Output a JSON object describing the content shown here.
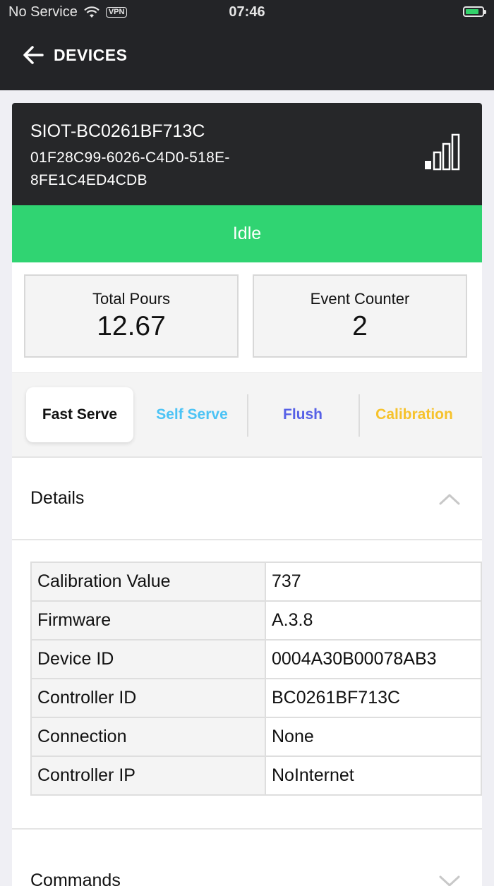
{
  "status_bar": {
    "carrier": "No Service",
    "vpn_label": "VPN",
    "time": "07:46"
  },
  "nav": {
    "back_icon": "arrow-left-icon",
    "title": "DEVICES"
  },
  "device": {
    "name": "SIOT-BC0261BF713C",
    "uuid": "01F28C99-6026-C4D0-518E-8FE1C4ED4CDB",
    "signal_icon": "signal-bars-icon",
    "state": "Idle",
    "state_color": "#30d472"
  },
  "stats": {
    "total_pours_label": "Total Pours",
    "total_pours_value": "12.67",
    "event_counter_label": "Event Counter",
    "event_counter_value": "2"
  },
  "modes": [
    {
      "label": "Fast Serve",
      "color": "#111111",
      "active": true
    },
    {
      "label": "Self Serve",
      "color": "#4cc3f5",
      "active": false
    },
    {
      "label": "Flush",
      "color": "#5660e6",
      "active": false
    },
    {
      "label": "Calibration",
      "color": "#f6c22b",
      "active": false
    }
  ],
  "details": {
    "title": "Details",
    "expanded": true,
    "rows": [
      {
        "key": "Calibration Value",
        "value": "737"
      },
      {
        "key": "Firmware",
        "value": "A.3.8"
      },
      {
        "key": "Device ID",
        "value": "0004A30B00078AB3"
      },
      {
        "key": "Controller ID",
        "value": "BC0261BF713C"
      },
      {
        "key": "Connection",
        "value": "None"
      },
      {
        "key": "Controller IP",
        "value": "NoInternet"
      }
    ]
  },
  "commands": {
    "title": "Commands",
    "expanded": false
  }
}
